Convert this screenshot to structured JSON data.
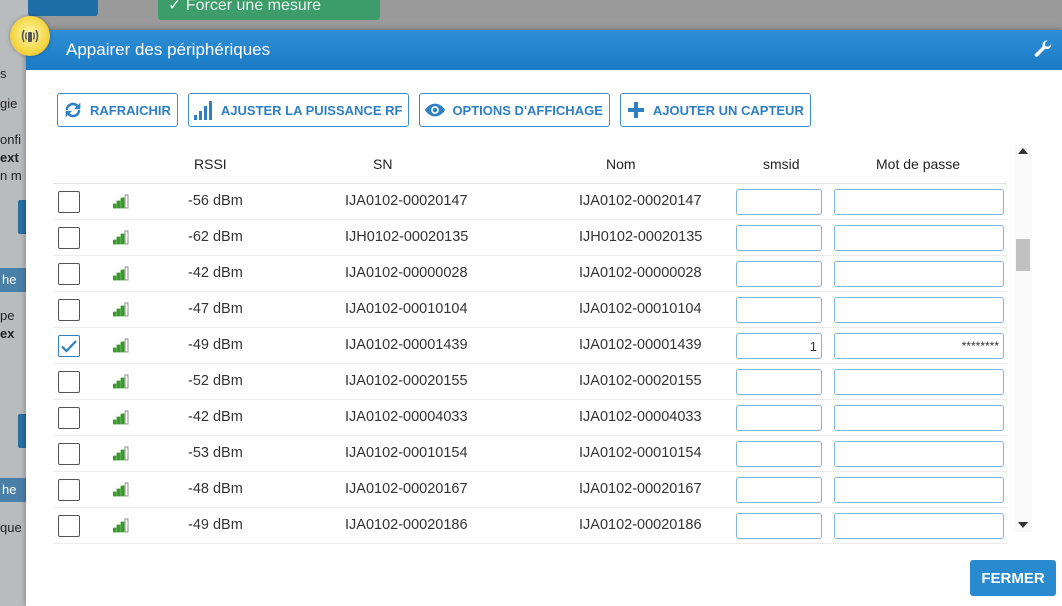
{
  "background": {
    "green_button_label": "✓ Forcer une mesure",
    "left_fragments": [
      "s",
      "gie",
      "onfi",
      "ext",
      "n m",
      "he",
      "pe",
      "ex",
      "he",
      "que"
    ]
  },
  "modal": {
    "title": "Appairer des périphériques",
    "header_color": "#1f80c8",
    "close_label": "FERMER"
  },
  "toolbar": {
    "refresh_label": "RAFRAICHIR",
    "rf_label": "AJUSTER LA PUISSANCE RF",
    "display_label": "OPTIONS D'AFFICHAGE",
    "add_label": "AJOUTER UN CAPTEUR"
  },
  "table": {
    "headers": {
      "rssi": "RSSI",
      "sn": "SN",
      "nom": "Nom",
      "smsid": "smsid",
      "password": "Mot de passe"
    },
    "rows": [
      {
        "checked": false,
        "signal_level": 3,
        "rssi": "-56 dBm",
        "sn": "IJA0102-00020147",
        "nom": "IJA0102-00020147",
        "smsid": "",
        "password": ""
      },
      {
        "checked": false,
        "signal_level": 3,
        "rssi": "-62 dBm",
        "sn": "IJH0102-00020135",
        "nom": "IJH0102-00020135",
        "smsid": "",
        "password": ""
      },
      {
        "checked": false,
        "signal_level": 3,
        "rssi": "-42 dBm",
        "sn": "IJA0102-00000028",
        "nom": "IJA0102-00000028",
        "smsid": "",
        "password": ""
      },
      {
        "checked": false,
        "signal_level": 3,
        "rssi": "-47 dBm",
        "sn": "IJA0102-00010104",
        "nom": "IJA0102-00010104",
        "smsid": "",
        "password": ""
      },
      {
        "checked": true,
        "signal_level": 3,
        "rssi": "-49 dBm",
        "sn": "IJA0102-00001439",
        "nom": "IJA0102-00001439",
        "smsid": "1",
        "password": "********"
      },
      {
        "checked": false,
        "signal_level": 3,
        "rssi": "-52 dBm",
        "sn": "IJA0102-00020155",
        "nom": "IJA0102-00020155",
        "smsid": "",
        "password": ""
      },
      {
        "checked": false,
        "signal_level": 3,
        "rssi": "-42 dBm",
        "sn": "IJA0102-00004033",
        "nom": "IJA0102-00004033",
        "smsid": "",
        "password": ""
      },
      {
        "checked": false,
        "signal_level": 3,
        "rssi": "-53 dBm",
        "sn": "IJA0102-00010154",
        "nom": "IJA0102-00010154",
        "smsid": "",
        "password": ""
      },
      {
        "checked": false,
        "signal_level": 3,
        "rssi": "-48 dBm",
        "sn": "IJA0102-00020167",
        "nom": "IJA0102-00020167",
        "smsid": "",
        "password": ""
      },
      {
        "checked": false,
        "signal_level": 3,
        "rssi": "-49 dBm",
        "sn": "IJA0102-00020186",
        "nom": "IJA0102-00020186",
        "smsid": "",
        "password": ""
      }
    ]
  },
  "icons": {
    "refresh": "refresh-icon",
    "rf": "signal-bars-icon",
    "display": "eye-icon",
    "add": "plus-icon",
    "header_right": "wrench-icon",
    "header_left": "antenna-logo-icon",
    "signal": "signal-strength-icon"
  },
  "colors": {
    "accent": "#2e7fc3",
    "signal_green": "#3a9a2e",
    "close_button": "#2a8ad0"
  }
}
